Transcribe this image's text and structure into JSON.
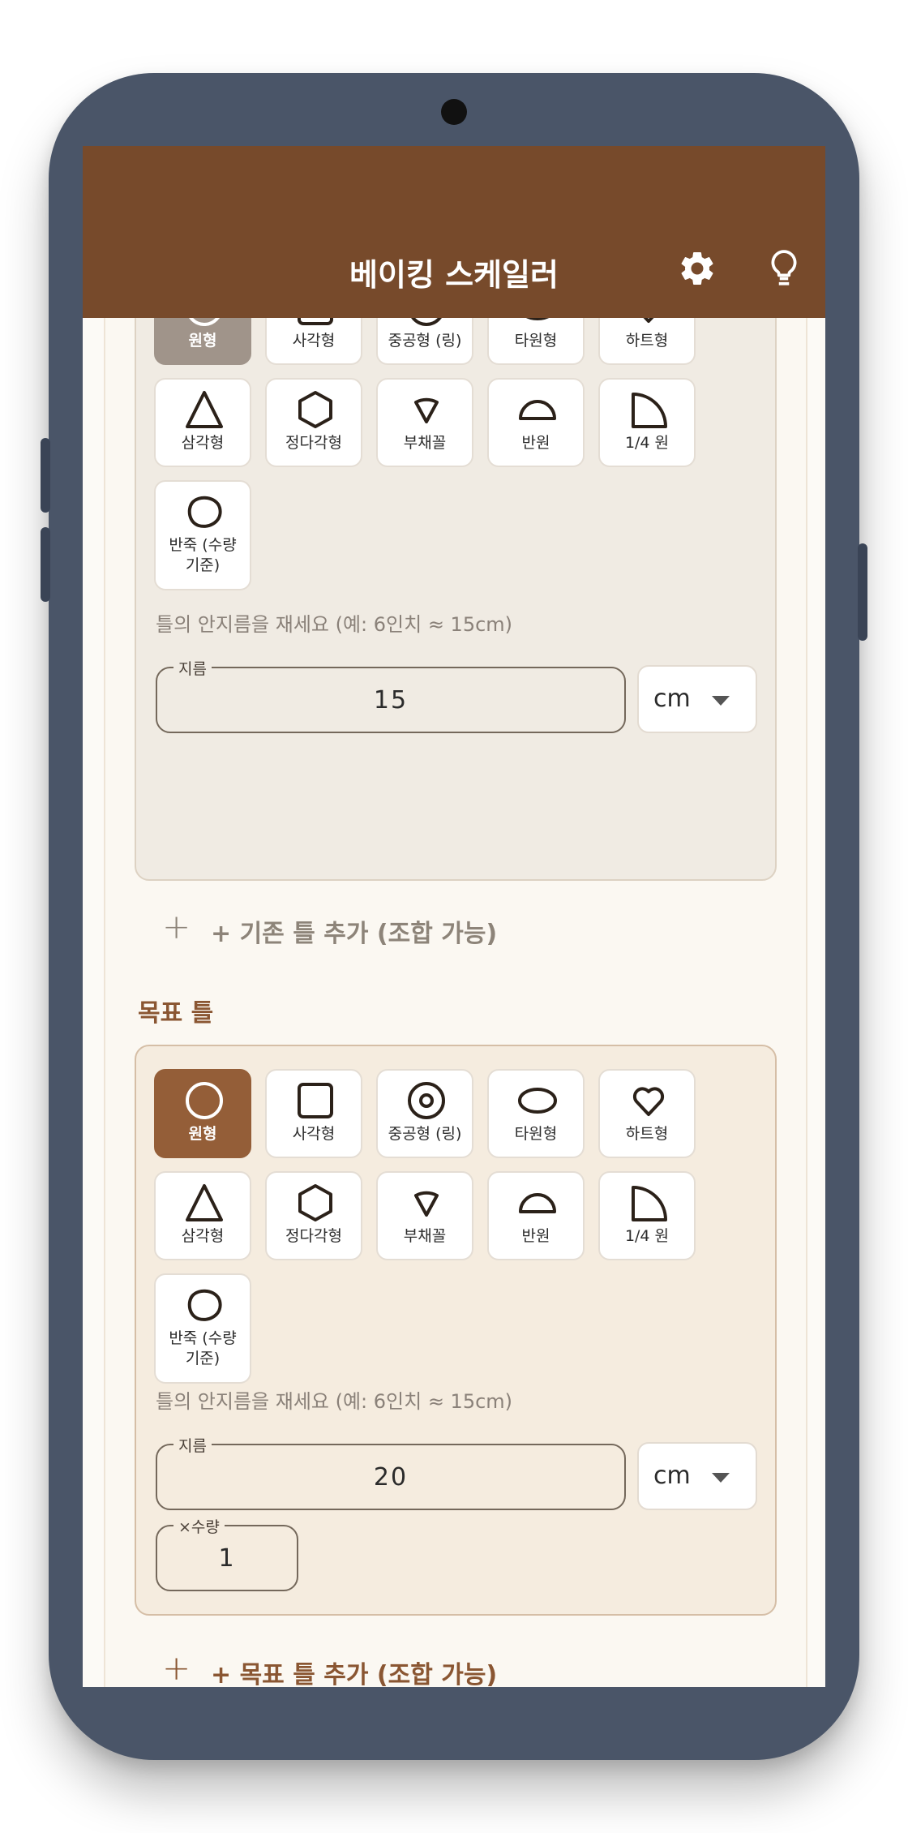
{
  "app": {
    "title": "베이킹 스케일러"
  },
  "colors": {
    "appbar": "#774a2b",
    "accent": "#8a5632",
    "selected_base": "#a0948a",
    "selected_target": "#945e38"
  },
  "icons": {
    "settings": "gear-icon",
    "tip": "lightbulb-icon"
  },
  "shapes": [
    "원형",
    "사각형",
    "중공형 (링)",
    "타원형",
    "하트형",
    "삼각형",
    "정다각형",
    "부채꼴",
    "반원",
    "1/4 원",
    "반죽 (수량 기준)"
  ],
  "base": {
    "shape_labels": [
      "원형",
      "사각형",
      "중공형 (링)",
      "타원형",
      "하트형",
      "삼각형",
      "정다각형",
      "부채꼴",
      "반원",
      "1/4 원",
      "반죽 (수량\n기준)"
    ],
    "selected": "원형",
    "hint": "틀의 안지름을 재세요 (예: 6인치 ≈ 15cm)",
    "diameter_label": "지름",
    "diameter_value": "15",
    "unit": "cm",
    "add_label": "+ 기존 틀 추가 (조합 가능)"
  },
  "target": {
    "section_title": "목표 틀",
    "shape_labels": [
      "원형",
      "사각형",
      "중공형 (링)",
      "타원형",
      "하트형",
      "삼각형",
      "정다각형",
      "부채꼴",
      "반원",
      "1/4 원",
      "반죽 (수량\n기준)"
    ],
    "selected": "원형",
    "hint": "틀의 안지름을 재세요 (예: 6인치 ≈ 15cm)",
    "diameter_label": "지름",
    "diameter_value": "20",
    "unit": "cm",
    "quantity_label": "×수량",
    "quantity_value": "1",
    "add_label": "+ 목표 틀 추가 (조합 가능)"
  },
  "add_symbol": "+"
}
